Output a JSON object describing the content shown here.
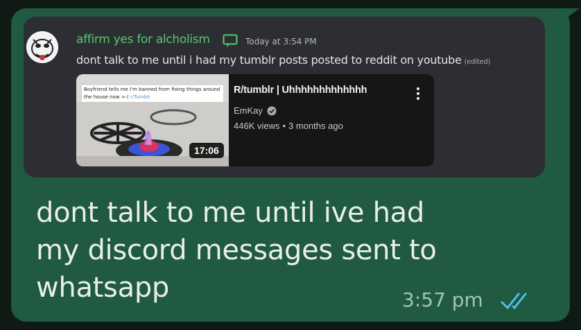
{
  "embed": {
    "username": "affirm yes for alcholism",
    "timestamp": "Today at 3:54 PM",
    "message": "dont talk to me until i had my tumblr posts posted to reddit on youtube",
    "edited_label": "(edited)",
    "youtube": {
      "thumbnail_caption": "Boyfriend tells me I'm banned from fixing things around the house now >:(",
      "thumbnail_tag": "r/Tumblr",
      "duration": "17:06",
      "title": "R/tumblr | Uhhhhhhhhhhhhh",
      "channel": "EmKay",
      "views": "446K views",
      "age": "3 months ago"
    }
  },
  "whatsapp": {
    "text_line1": "dont talk to me until ive had",
    "text_line2": "my discord messages sent to",
    "text_line3": "whatsapp",
    "time": "3:57 pm",
    "status_icon": "double-check-read-icon"
  },
  "colors": {
    "bubble": "#1f5a41",
    "embed_bg": "#2d2e33",
    "username": "#56c96b",
    "read_ticks": "#53bdeb"
  }
}
